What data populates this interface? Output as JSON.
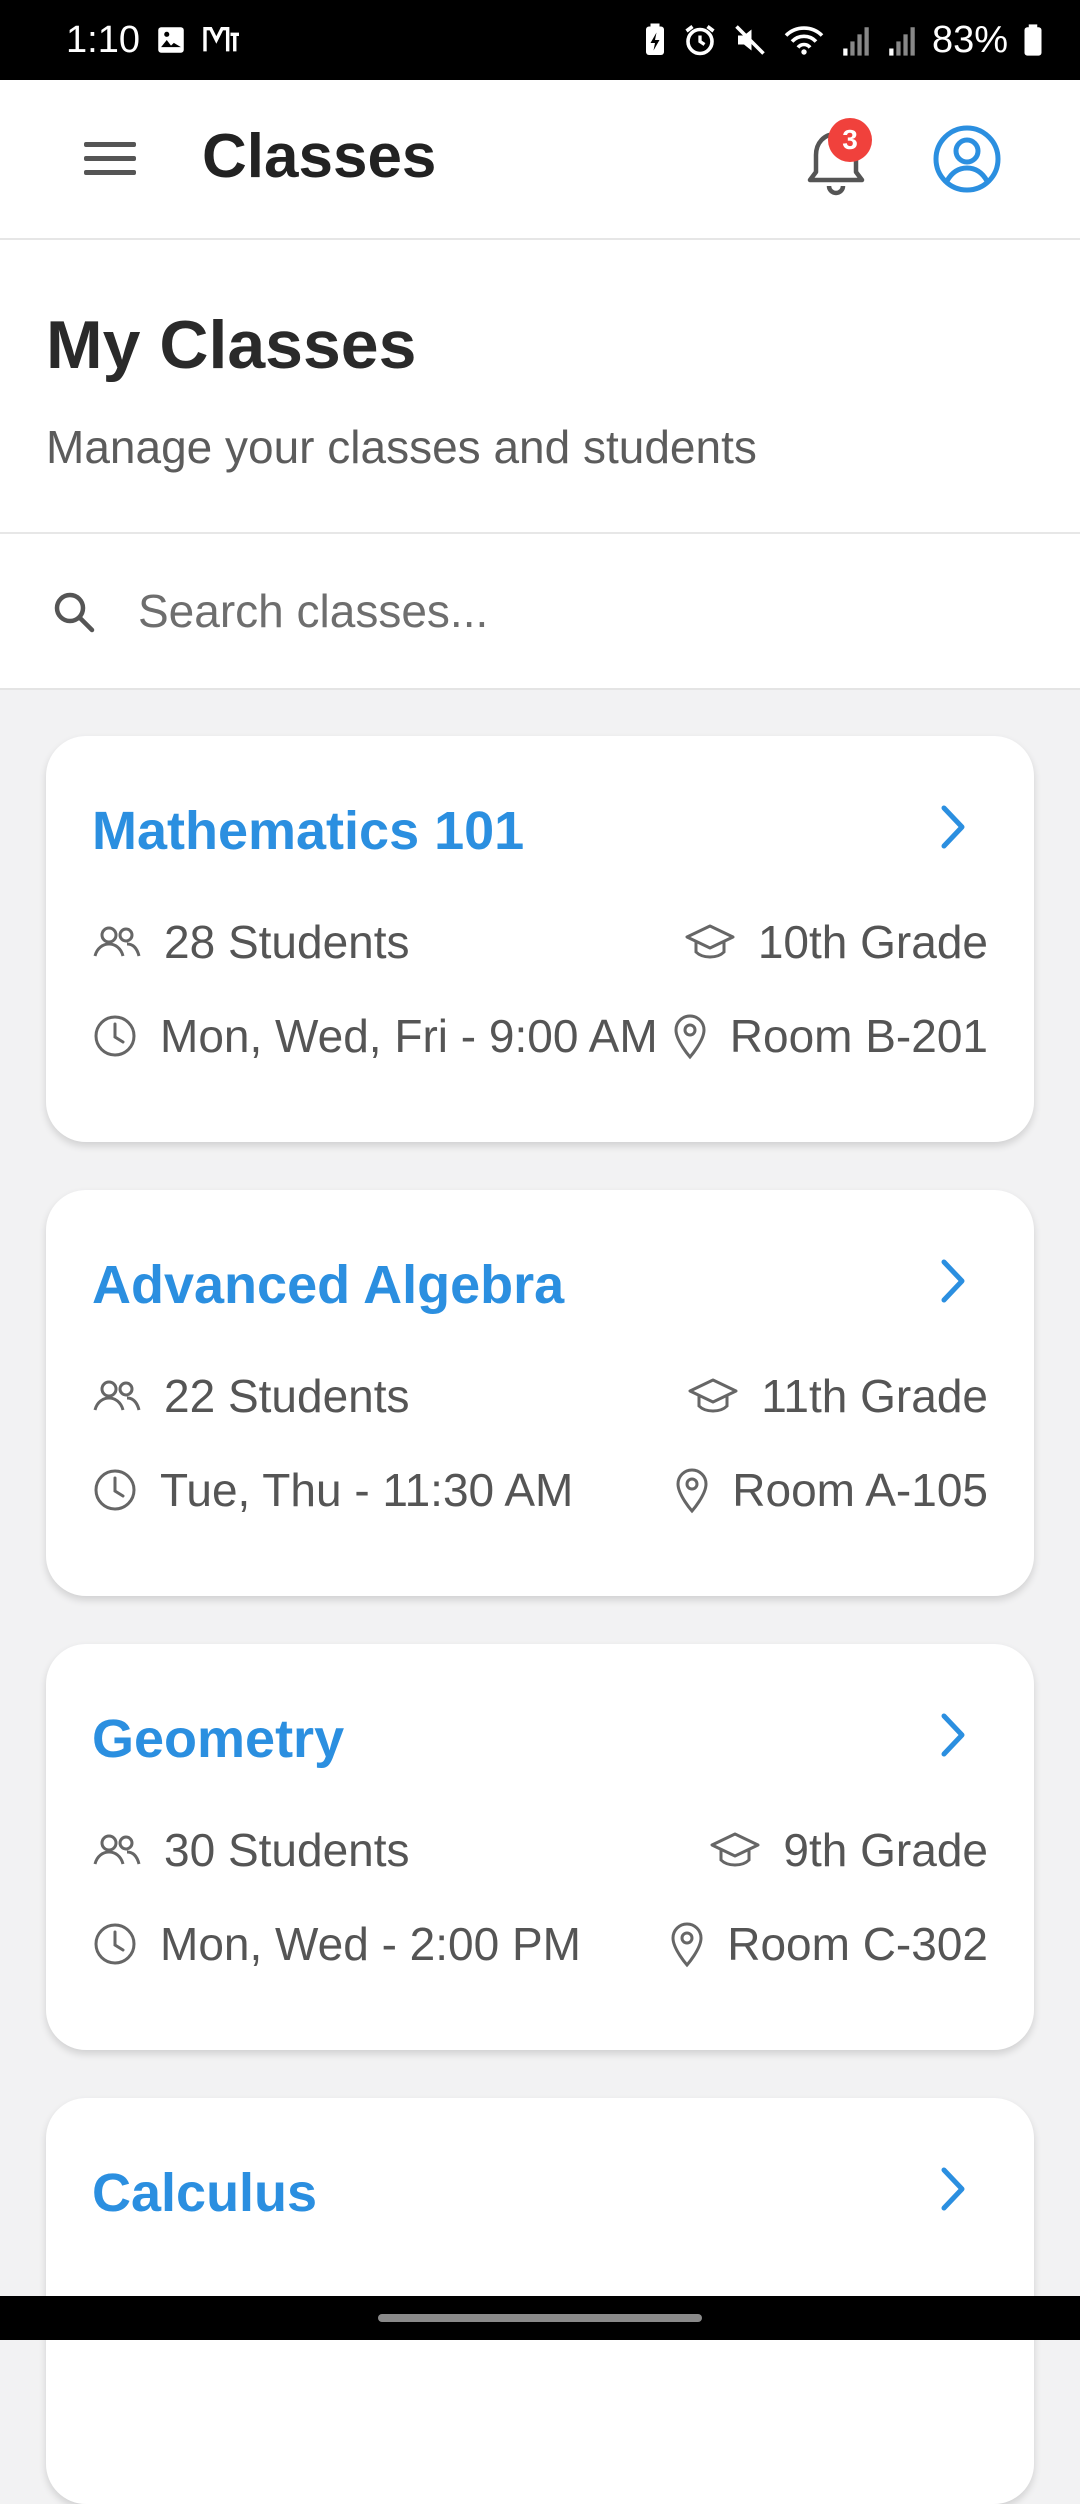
{
  "status_bar": {
    "time": "1:10",
    "battery_percent": "83%",
    "icons": [
      "image-icon",
      "m-icon",
      "battery-saver-icon",
      "alarm-icon",
      "mute-icon",
      "wifi-icon",
      "signal-icon",
      "signal-icon",
      "battery-icon"
    ]
  },
  "app_bar": {
    "title": "Classes",
    "notification_count": "3",
    "icons": [
      "menu-icon",
      "bell-icon",
      "account-icon"
    ]
  },
  "header": {
    "title": "My Classes",
    "subtitle": "Manage your classes and students"
  },
  "search": {
    "placeholder": "Search classes...",
    "value": ""
  },
  "classes": [
    {
      "name": "Mathematics 101",
      "students": "28 Students",
      "grade": "10th Grade",
      "schedule": "Mon, Wed, Fri - 9:00 AM",
      "room": "Room B-201"
    },
    {
      "name": "Advanced Algebra",
      "students": "22 Students",
      "grade": "11th Grade",
      "schedule": "Tue, Thu - 11:30 AM",
      "room": "Room A-105"
    },
    {
      "name": "Geometry",
      "students": "30 Students",
      "grade": "9th Grade",
      "schedule": "Mon, Wed - 2:00 PM",
      "room": "Room C-302"
    },
    {
      "name": "Calculus",
      "students": "",
      "grade": "",
      "schedule": "",
      "room": ""
    }
  ],
  "colors": {
    "accent": "#2b8fe0",
    "badge": "#f0413c",
    "background": "#f2f2f3"
  }
}
